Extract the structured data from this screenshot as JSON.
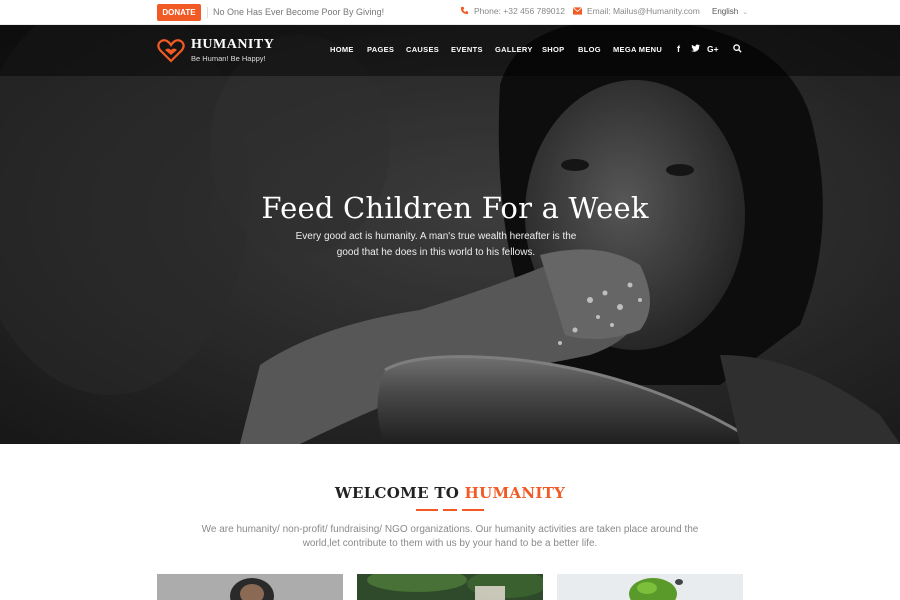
{
  "topbar": {
    "donate_label": "DONATE",
    "tagline": "No One Has Ever Become Poor By Giving!",
    "phone": "Phone: +32 456 789012",
    "email": "Email: Mailus@Humanity.com",
    "language": "English"
  },
  "brand": {
    "name": "HUMANITY",
    "slogan": "Be Human! Be Happy!",
    "accent_color": "#f15a24"
  },
  "nav": {
    "items": [
      "HOME",
      "PAGES",
      "CAUSES",
      "EVENTS",
      "GALLERY",
      "SHOP",
      "BLOG",
      "MEGA MENU"
    ],
    "social_icons": [
      "facebook-icon",
      "twitter-icon",
      "google-plus-icon"
    ],
    "search_icon": "search-icon"
  },
  "hero": {
    "title": "Feed Children For a Week",
    "text": "Every good act is humanity. A man's true wealth hereafter is the good that he does in this world to his fellows."
  },
  "welcome": {
    "title_prefix": "WELCOME TO ",
    "title_accent": "HUMANITY",
    "text": "We are humanity/ non-profit/ fundraising/ NGO organizations. Our humanity activities are taken place around the world,let contribute to them with us by your hand to be a better life."
  }
}
